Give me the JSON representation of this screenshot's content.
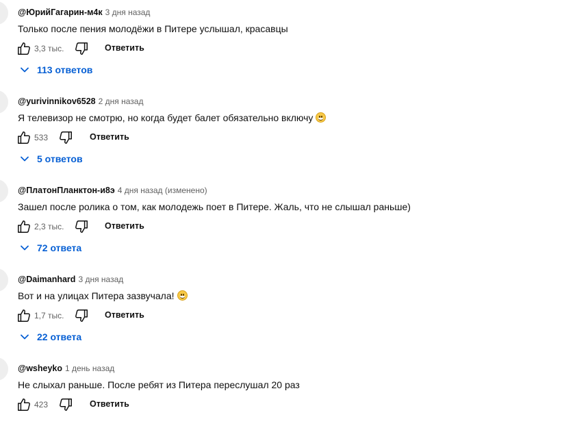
{
  "comments": [
    {
      "author": "@ЮрийГагарин-м4к",
      "time": "3 дня назад",
      "text": "Только после пения молодёжи в Питере услышал, красавцы",
      "has_emoji": false,
      "likes": "3,3 тыс.",
      "reply_label": "Ответить",
      "replies_label": "113 ответов"
    },
    {
      "author": "@yurivinnikov6528",
      "time": "2 дня назад",
      "text": "Я телевизор не смотрю, но когда будет балет обязательно включу",
      "has_emoji": true,
      "likes": "533",
      "reply_label": "Ответить",
      "replies_label": "5 ответов"
    },
    {
      "author": "@ПлатонПланктон-и8э",
      "time": "4 дня назад (изменено)",
      "text": "Зашел после ролика о том, как молодежь поет в Питере. Жаль, что не слышал раньше)",
      "has_emoji": false,
      "likes": "2,3 тыс.",
      "reply_label": "Ответить",
      "replies_label": "72 ответа"
    },
    {
      "author": "@Daimanhard",
      "time": "3 дня назад",
      "text": "Вот и на улицах Питера зазвучала!",
      "has_emoji": true,
      "likes": "1,7 тыс.",
      "reply_label": "Ответить",
      "replies_label": "22 ответа"
    },
    {
      "author": "@wsheyko",
      "time": "1 день назад",
      "text": "Не слыхал раньше. После ребят из Питера переслушал 20 раз",
      "has_emoji": false,
      "likes": "423",
      "reply_label": "Ответить",
      "replies_label": ""
    }
  ],
  "icons": {
    "like": "thumbs-up-icon",
    "dislike": "thumbs-down-icon",
    "expand": "chevron-down-icon",
    "emoji": "grinning-face-icon"
  },
  "colors": {
    "text": "#0f0f0f",
    "secondary": "#606060",
    "link": "#065fd4"
  }
}
